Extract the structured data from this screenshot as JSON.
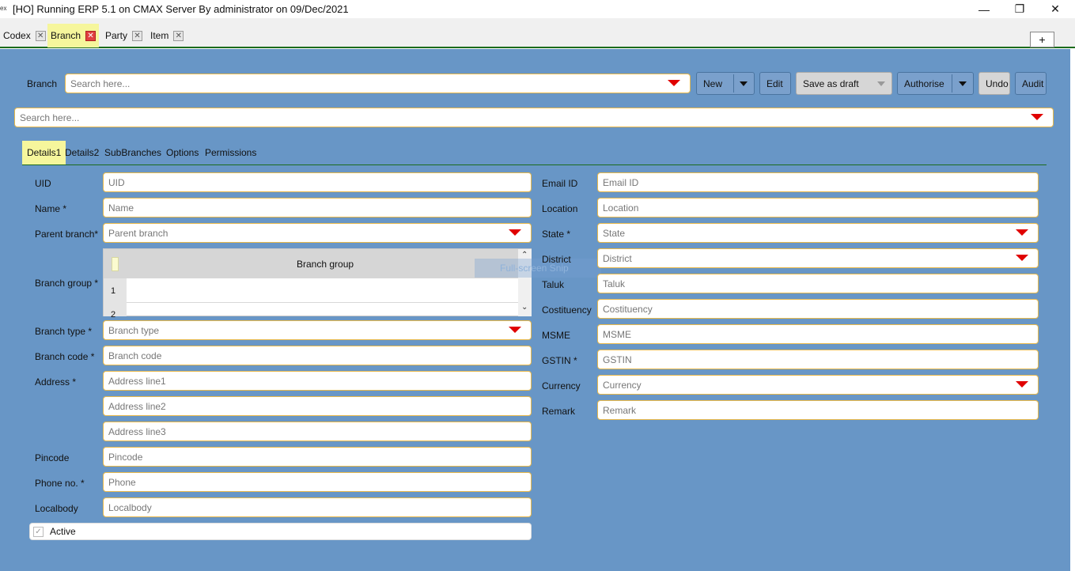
{
  "window": {
    "icon_text": "ex",
    "title": "[HO] Running ERP 5.1 on CMAX Server By administrator on 09/Dec/2021",
    "minimize": "—",
    "restore": "❐",
    "close": "✕"
  },
  "tabs": [
    {
      "label": "Codex",
      "close": "✕"
    },
    {
      "label": "Branch",
      "close": "✕"
    },
    {
      "label": "Party",
      "close": "✕"
    },
    {
      "label": "Item",
      "close": "✕"
    }
  ],
  "new_tab_label": "+",
  "toolbar": {
    "branch_label": "Branch",
    "search_placeholder": "Search here...",
    "new_label": "New",
    "edit_label": "Edit",
    "save_draft_label": "Save as draft",
    "authorise_label": "Authorise",
    "undo_label": "Undo",
    "audit_label": "Audit"
  },
  "search2_placeholder": "Search here...",
  "subtabs": [
    "Details1",
    "Details2",
    "SubBranches",
    "Options",
    "Permissions"
  ],
  "form_left": {
    "uid": {
      "label": "UID",
      "placeholder": "UID"
    },
    "name": {
      "label": "Name *",
      "placeholder": "Name"
    },
    "parent_branch": {
      "label": "Parent branch*",
      "placeholder": "Parent branch"
    },
    "branch_group": {
      "label": "Branch group *",
      "grid_header": "Branch group",
      "rows": [
        "1",
        "2"
      ]
    },
    "branch_type": {
      "label": "Branch type *",
      "placeholder": "Branch type"
    },
    "branch_code": {
      "label": "Branch code *",
      "placeholder": "Branch code"
    },
    "address": {
      "label": "Address *",
      "line1": "Address line1",
      "line2": "Address line2",
      "line3": "Address line3"
    },
    "pincode": {
      "label": "Pincode",
      "placeholder": "Pincode"
    },
    "phone": {
      "label": "Phone no. *",
      "placeholder": "Phone"
    },
    "localbody": {
      "label": "Localbody",
      "placeholder": "Localbody"
    },
    "active": {
      "label": "Active",
      "check": "✓"
    }
  },
  "form_right": {
    "email": {
      "label": "Email ID",
      "placeholder": "Email ID"
    },
    "location": {
      "label": "Location",
      "placeholder": "Location"
    },
    "state": {
      "label": "State *",
      "placeholder": "State"
    },
    "district": {
      "label": "District",
      "placeholder": "District"
    },
    "taluk": {
      "label": "Taluk",
      "placeholder": "Taluk"
    },
    "costituency": {
      "label": "Costituency",
      "placeholder": "Costituency"
    },
    "msme": {
      "label": "MSME",
      "placeholder": "MSME"
    },
    "gstin": {
      "label": "GSTIN *",
      "placeholder": "GSTIN"
    },
    "currency": {
      "label": "Currency",
      "placeholder": "Currency"
    },
    "remark": {
      "label": "Remark",
      "placeholder": "Remark"
    }
  },
  "snip_overlay": "Full-screen Snip",
  "colors": {
    "panel": "#6896c6",
    "active_tab": "#f6f69c",
    "field_border": "#e8b84a",
    "dropdown_arrow": "#e00000",
    "tab_underline": "#1c6b1c"
  }
}
